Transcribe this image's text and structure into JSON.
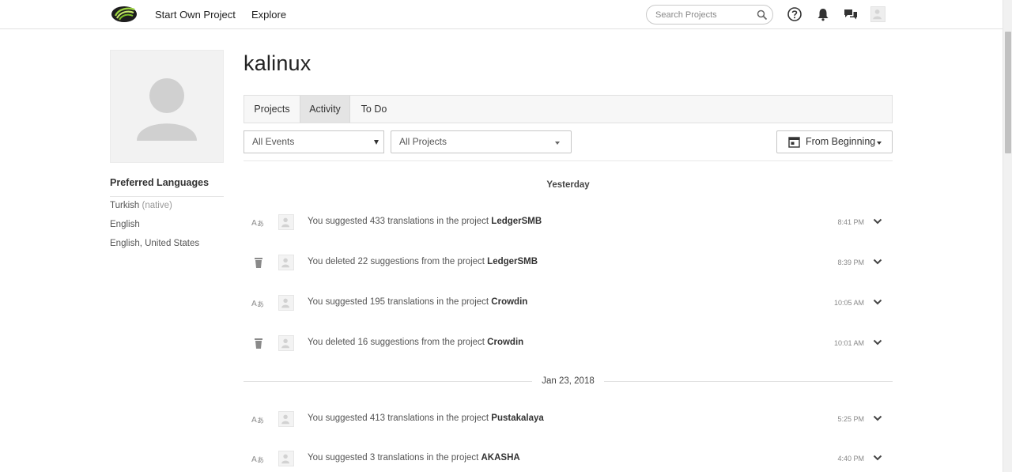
{
  "header": {
    "nav": [
      "Start Own Project",
      "Explore"
    ],
    "search_placeholder": "Search Projects"
  },
  "profile": {
    "username": "kalinux",
    "preferred_languages_title": "Preferred Languages",
    "languages": [
      {
        "name": "Turkish",
        "note": "(native)"
      },
      {
        "name": "English",
        "note": ""
      },
      {
        "name": "English, United States",
        "note": ""
      }
    ]
  },
  "tabs": [
    "Projects",
    "Activity",
    "To Do"
  ],
  "active_tab": "Activity",
  "filters": {
    "events": "All Events",
    "projects": "All Projects",
    "period": "From Beginning"
  },
  "activity": [
    {
      "day": "Yesterday",
      "events": [
        {
          "type": "translate-icon",
          "text": "You suggested 433 translations in the project ",
          "project": "LedgerSMB",
          "time": "8:41 PM"
        },
        {
          "type": "trash-icon",
          "text": "You deleted 22 suggestions from the project ",
          "project": "LedgerSMB",
          "time": "8:39 PM"
        },
        {
          "type": "translate-icon",
          "text": "You suggested 195 translations in the project ",
          "project": "Crowdin",
          "time": "10:05 AM"
        },
        {
          "type": "trash-icon",
          "text": "You deleted 16 suggestions from the project ",
          "project": "Crowdin",
          "time": "10:01 AM"
        }
      ]
    },
    {
      "day": "Jan 23, 2018",
      "events": [
        {
          "type": "translate-icon",
          "text": "You suggested 413 translations in the project ",
          "project": "Pustakalaya",
          "time": "5:25 PM"
        },
        {
          "type": "translate-icon",
          "text": "You suggested 3 translations in the project ",
          "project": "AKASHA",
          "time": "4:40 PM"
        }
      ]
    }
  ],
  "colors": {
    "logo_green": "#8dc63f",
    "icon_grey": "#8a8a8a",
    "tab_active_bg": "#e4e4e4"
  }
}
